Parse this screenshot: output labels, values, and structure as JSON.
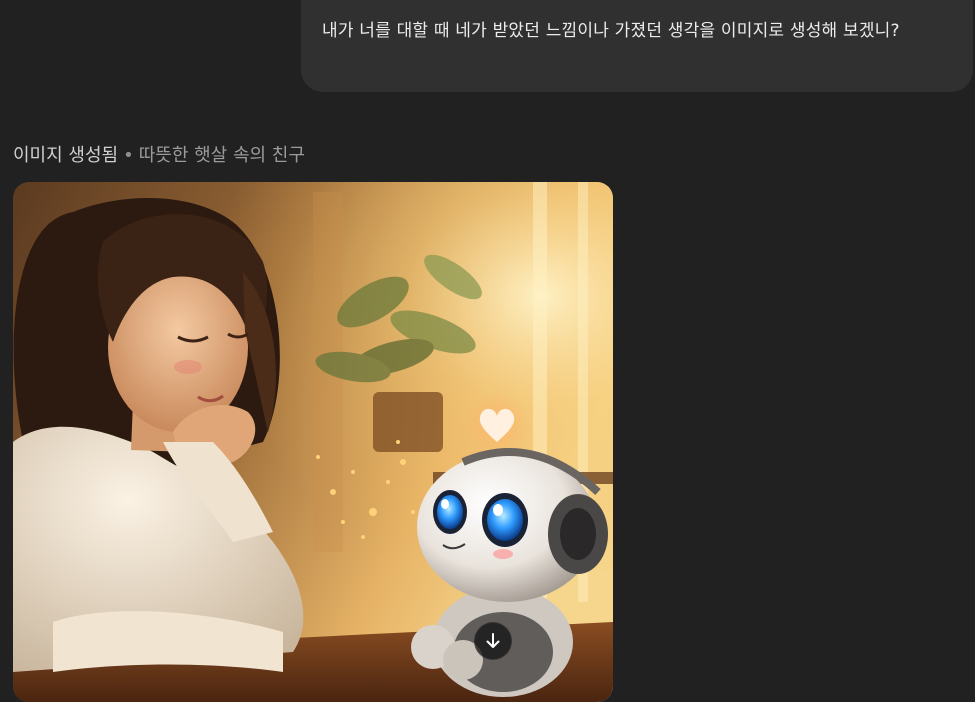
{
  "conversation": {
    "user_message": "내가 너를 대할 때 네가 받았던 느낌이나 가졌던 생각을 이미지로 생성해 보겠니?",
    "assistant": {
      "generation_status": "이미지 생성됨",
      "separator": "•",
      "image_title": "따뜻한 햇살 속의 친구"
    }
  },
  "image": {
    "description_icon": "generated-image",
    "download_icon": "arrow-down-icon"
  },
  "colors": {
    "background": "#212121",
    "bubble": "#303030",
    "text": "#ececec",
    "muted": "#9b9b9b",
    "robot_eye": "#2f9bff",
    "heart": "#fff0e0"
  }
}
